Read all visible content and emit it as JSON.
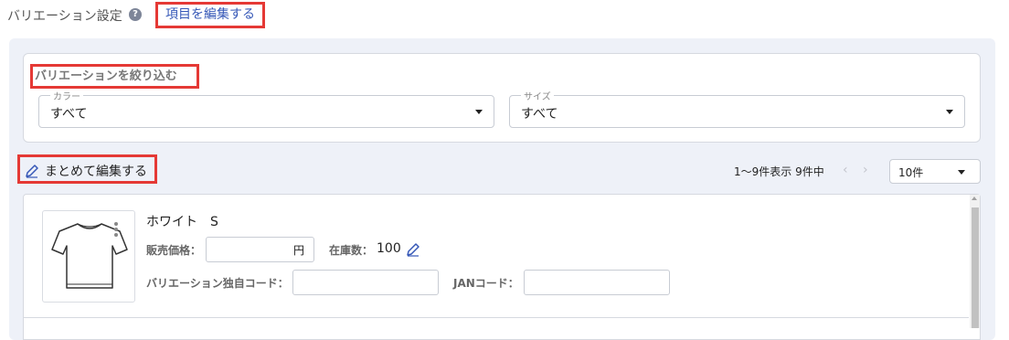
{
  "header": {
    "title": "バリエーション設定",
    "help_icon": "question-circle-icon",
    "help_glyph": "?",
    "edit_items_label": "項目を編集する"
  },
  "filter": {
    "title": "バリエーションを絞り込む",
    "color": {
      "label": "カラー",
      "value": "すべて"
    },
    "size": {
      "label": "サイズ",
      "value": "すべて"
    }
  },
  "toolbar": {
    "bulk_edit_label": "まとめて編集する",
    "bulk_edit_icon": "pencil-icon",
    "count_text": "1～9件表示 9件中",
    "prev_icon": "chevron-left-icon",
    "prev_glyph": "‹",
    "next_icon": "chevron-right-icon",
    "next_glyph": "›",
    "per_page": "10件"
  },
  "variation": {
    "name": "ホワイト　S",
    "image_icon": "tshirt-icon",
    "price_label": "販売価格：",
    "price_value": "",
    "price_unit": "円",
    "stock_label": "在庫数：",
    "stock_value": "100",
    "stock_edit_icon": "pencil-icon",
    "code_label": "バリエーション独自コード：",
    "code_value": "",
    "jan_label": "JANコード：",
    "jan_value": ""
  },
  "colors": {
    "accent": "#3557b7",
    "highlight": "#e53935",
    "panel_bg": "#eef1f8"
  }
}
